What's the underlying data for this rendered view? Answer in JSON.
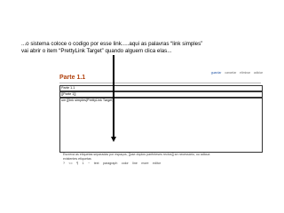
{
  "annotation": {
    "line1": "...o sistema coloce o codigo por esse link.....aqui as palavras “link simples”",
    "line2": "vai abrir o item “PrettyLink Target” quando alguem clica elas..."
  },
  "editor": {
    "top_links": [
      "guardar",
      "cancelar",
      "eliminar",
      "adiciar"
    ],
    "title": "Parte 1.1",
    "field1_value": "Parte 1.1",
    "field2_value": "[[Parte 1]]",
    "content_value": "um [[link simples|PrettyLink Target]]",
    "help_line1": "Escreva as etiquetas separadas por espaços, [[use duplos parênteses rectos]] se necessário, ou adicua",
    "help_line2": "existentes etiquetas",
    "format_buttons": [
      "?",
      "<=",
      "¶",
      "1",
      "~",
      "text",
      "paragraph",
      "color",
      "line",
      "more",
      "editor"
    ]
  },
  "colors": {
    "title": "#b0400c",
    "link": "#2a5aa8"
  }
}
